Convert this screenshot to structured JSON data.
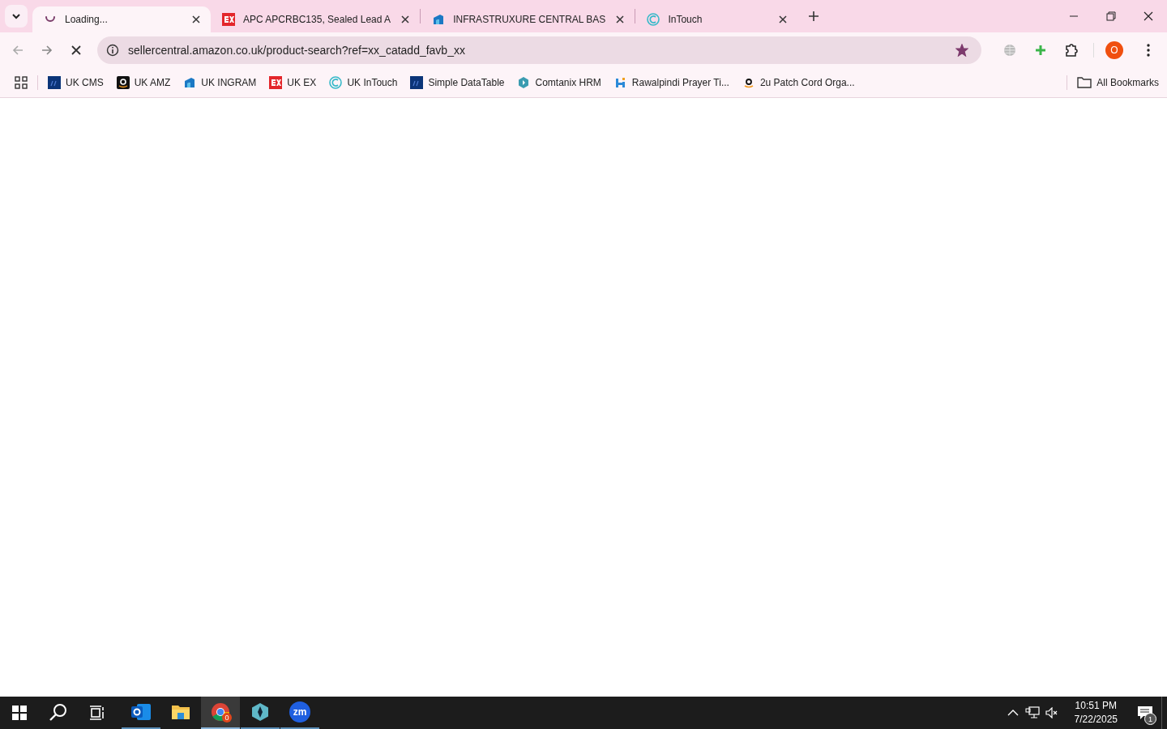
{
  "tabs": [
    {
      "title": "Loading...",
      "kind": "spinner",
      "selected": true
    },
    {
      "title": "APC APCRBC135, Sealed Lead A",
      "kind": "ex",
      "selected": false
    },
    {
      "title": "INFRASTRUXURE CENTRAL BAS",
      "kind": "ingram",
      "selected": false
    },
    {
      "title": "InTouch",
      "kind": "intouch",
      "selected": false
    }
  ],
  "address_bar": {
    "url": "sellercentral.amazon.co.uk/product-search?ref=xx_catadd_favb_xx",
    "bookmarked": true
  },
  "profile": {
    "initial": "O"
  },
  "bookmarks": [
    {
      "label": "UK CMS",
      "kind": "df"
    },
    {
      "label": "UK AMZ",
      "kind": "amazon"
    },
    {
      "label": "UK INGRAM",
      "kind": "ingram"
    },
    {
      "label": "UK EX",
      "kind": "ex"
    },
    {
      "label": "UK InTouch",
      "kind": "intouch"
    },
    {
      "label": "Simple DataTable",
      "kind": "df"
    },
    {
      "label": "Comtanix HRM",
      "kind": "hex"
    },
    {
      "label": "Rawalpindi Prayer Ti...",
      "kind": "h"
    },
    {
      "label": "2u Patch Cord Orga...",
      "kind": "amazonlight"
    }
  ],
  "all_bookmarks": "All Bookmarks",
  "taskbar": {
    "apps": [
      {
        "kind": "outlook",
        "running": true,
        "selected": false
      },
      {
        "kind": "folder",
        "running": false,
        "selected": false
      },
      {
        "kind": "chrome",
        "running": true,
        "selected": true,
        "badge": "0"
      },
      {
        "kind": "hexapp",
        "running": true,
        "selected": false
      },
      {
        "kind": "zoom",
        "running": true,
        "selected": false,
        "label": "zm"
      }
    ],
    "time": "10:51 PM",
    "date": "7/22/2025",
    "notifications": "1"
  }
}
